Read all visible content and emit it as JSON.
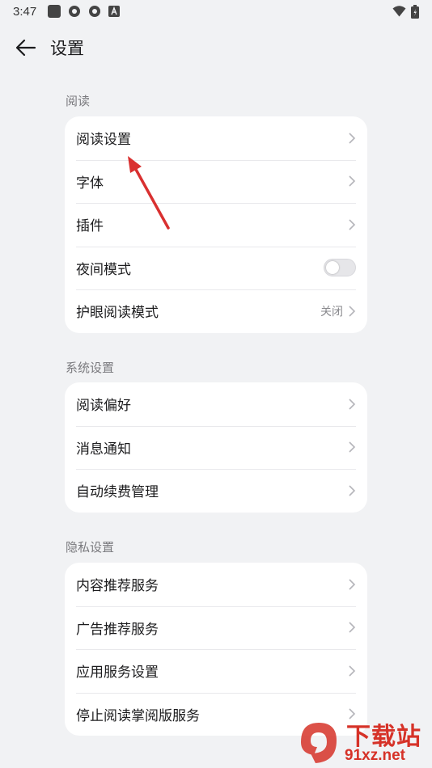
{
  "status_bar": {
    "time": "3:47"
  },
  "header": {
    "title": "设置"
  },
  "sections": [
    {
      "title": "阅读",
      "items": [
        {
          "label": "阅读设置"
        },
        {
          "label": "字体"
        },
        {
          "label": "插件"
        },
        {
          "label": "夜间模式",
          "toggle": false
        },
        {
          "label": "护眼阅读模式",
          "value": "关闭"
        }
      ]
    },
    {
      "title": "系统设置",
      "items": [
        {
          "label": "阅读偏好"
        },
        {
          "label": "消息通知"
        },
        {
          "label": "自动续费管理"
        }
      ]
    },
    {
      "title": "隐私设置",
      "items": [
        {
          "label": "内容推荐服务"
        },
        {
          "label": "广告推荐服务"
        },
        {
          "label": "应用服务设置"
        },
        {
          "label": "停止阅读掌阅版服务"
        }
      ]
    }
  ],
  "watermark": {
    "title": "下载站",
    "url": "91xz.net"
  },
  "colors": {
    "background": "#f1f2f4",
    "card": "#ffffff",
    "annotation_arrow": "#d93030",
    "watermark": "#d63228"
  }
}
